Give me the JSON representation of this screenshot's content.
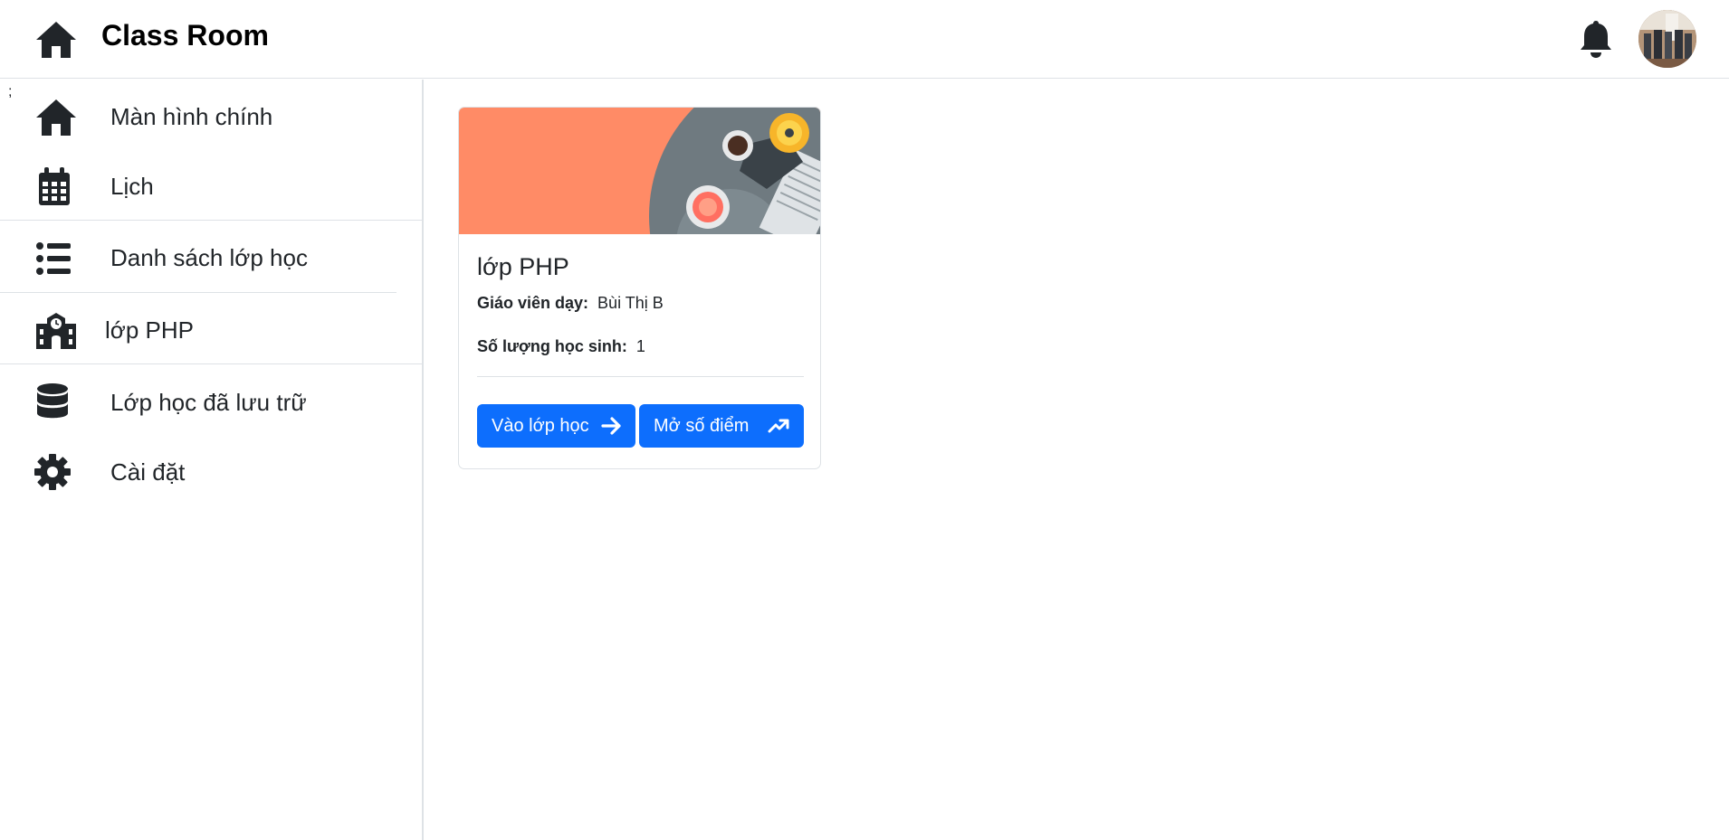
{
  "header": {
    "brand": "Class Room",
    "home_icon": "home-icon",
    "notifications_icon": "bell-icon"
  },
  "stray_text": ";",
  "sidebar": {
    "items": [
      {
        "label": "Màn hình chính",
        "icon": "home-icon"
      },
      {
        "label": "Lịch",
        "icon": "calendar-icon"
      },
      {
        "label": "Danh sách lớp học",
        "icon": "list-icon"
      },
      {
        "label": "lớp PHP",
        "icon": "school-icon"
      },
      {
        "label": "Lớp học đã lưu trữ",
        "icon": "database-icon"
      },
      {
        "label": "Cài đặt",
        "icon": "gear-icon"
      }
    ]
  },
  "class_card": {
    "title": "lớp PHP",
    "teacher_label": "Giáo viên dạy:",
    "teacher_value": "Bùi Thị B",
    "students_label": "Số lượng học sinh:",
    "students_value": "1",
    "enter_button": "Vào lớp học",
    "gradebook_button": "Mở số điểm",
    "banner_color": "#ff8b66",
    "button_color": "#0d6efd"
  }
}
